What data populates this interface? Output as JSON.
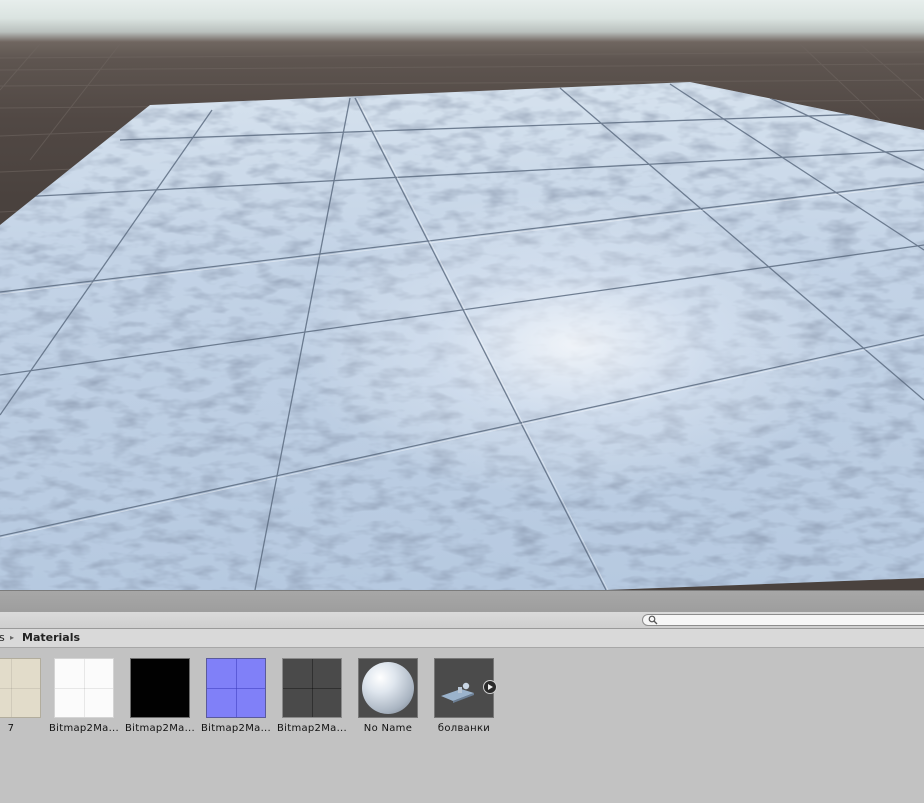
{
  "project": {
    "breadcrumb_parent": "s",
    "breadcrumb_arrow": "▸",
    "breadcrumb_current": "Materials",
    "search": {
      "value": "",
      "placeholder": ""
    }
  },
  "assets": [
    {
      "label": "7",
      "thumb": "beige-tile-texture"
    },
    {
      "label": "Bitmap2Ma...",
      "thumb": "white-tile-texture"
    },
    {
      "label": "Bitmap2Ma...",
      "thumb": "black-texture"
    },
    {
      "label": "Bitmap2Ma...",
      "thumb": "normal-map-texture"
    },
    {
      "label": "Bitmap2Ma...",
      "thumb": "dark-tile-texture"
    },
    {
      "label": "No Name",
      "thumb": "material-sphere-preview"
    },
    {
      "label": "болванки",
      "thumb": "prefab-preview"
    }
  ],
  "colors": {
    "floor": "#c4d6ea",
    "scene_background": "#4f4742",
    "sky_horizon": "#dfe8e5",
    "panel": "#c2c2c2"
  },
  "icons": {
    "search": "search-icon",
    "expand": "play-arrow-icon"
  }
}
